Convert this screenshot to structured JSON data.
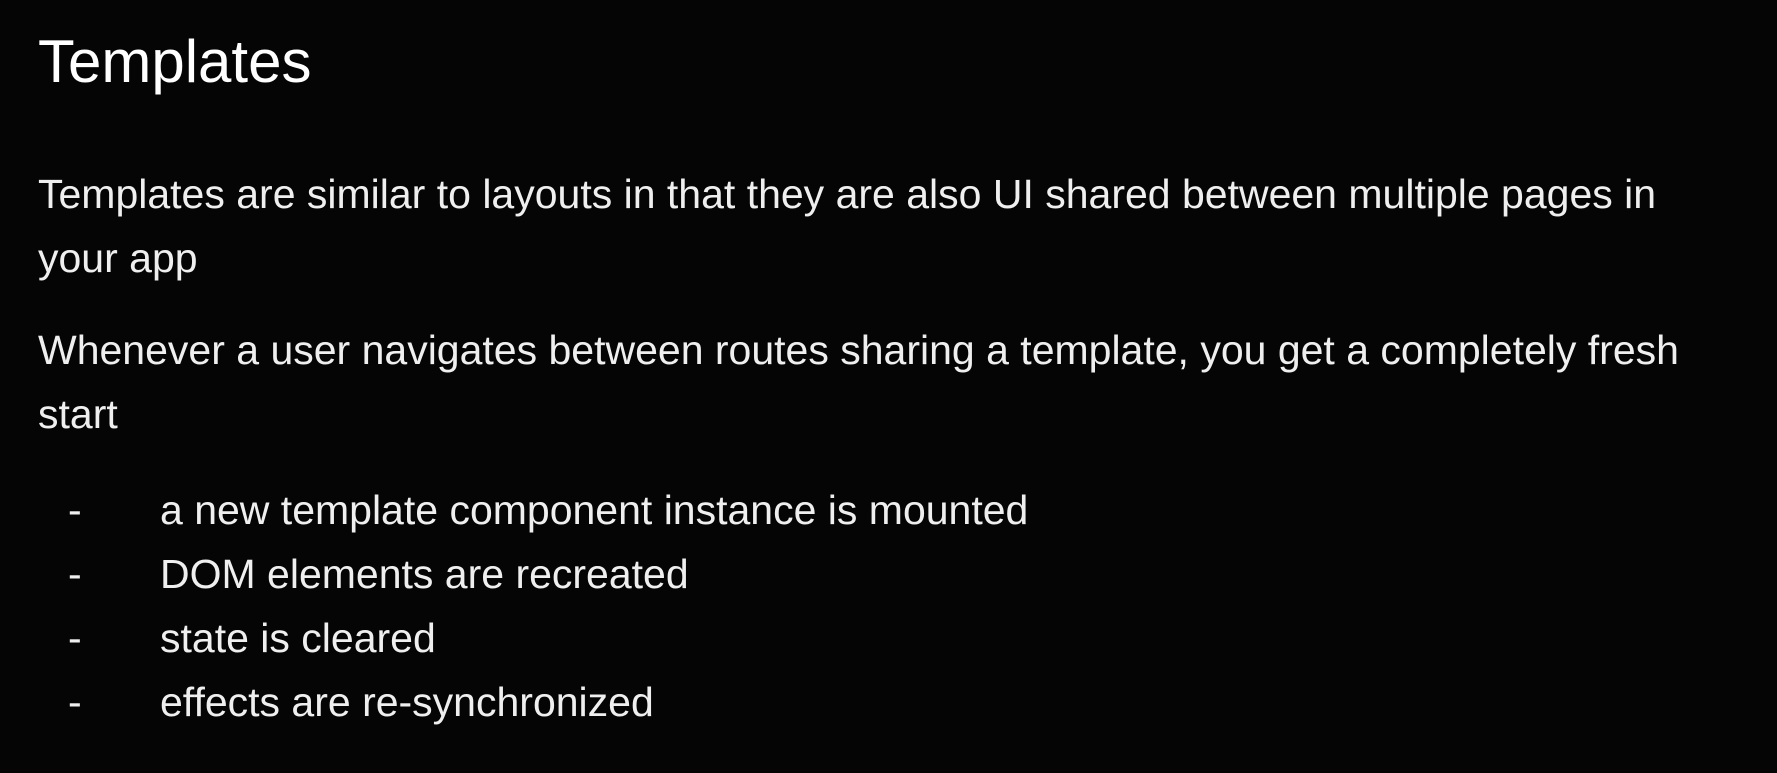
{
  "slide": {
    "title": "Templates",
    "paragraphs": [
      "Templates are similar to layouts in that they are also UI shared between multiple pages in your app",
      "Whenever a user navigates between routes sharing a template, you get a completely fresh start"
    ],
    "bullet_marker": "-",
    "bullets": [
      "a new template component instance is mounted",
      "DOM elements are recreated",
      "state is cleared",
      "effects are re-synchronized"
    ]
  },
  "colors": {
    "background": "#050505",
    "text": "#efefef",
    "title": "#ffffff"
  }
}
